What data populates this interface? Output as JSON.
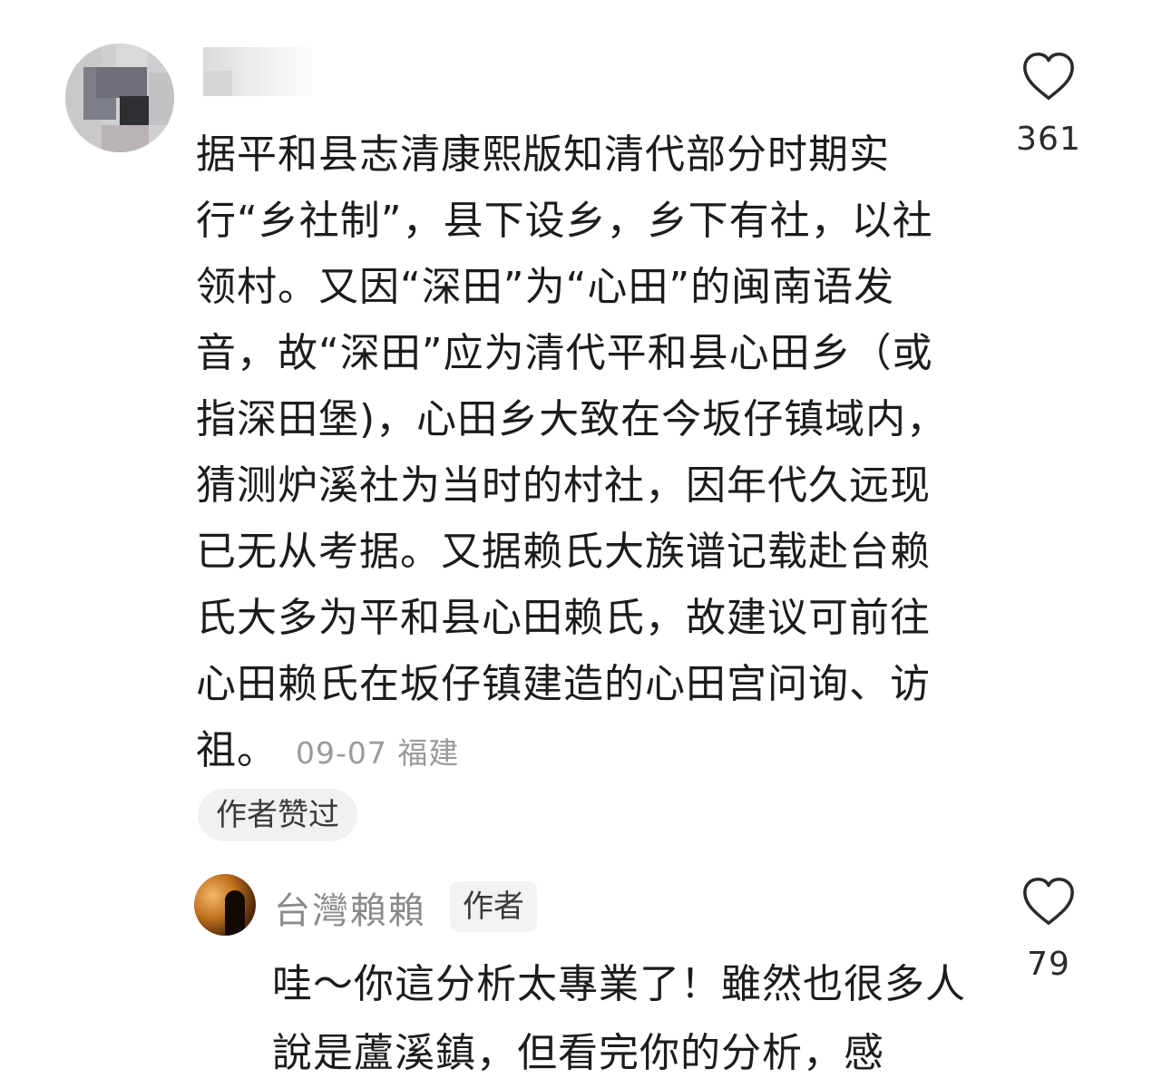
{
  "comment": {
    "avatar": "blurred-avatar",
    "username": "",
    "text": "据平和县志清康熙版知清代部分时期实行“乡社制”，县下设乡，乡下有社，以社领村。又因“深田”为“心田”的闽南语发音，故“深田”应为清代平和县心田乡（或指深田堡)，心田乡大致在今坂仔镇域内，猜测炉溪社为当时的村社，因年代久远现已无从考据。又据赖氏大族谱记载赴台赖氏大多为平和县心田赖氏，故建议可前往心田赖氏在坂仔镇建造的心田宫问询、访祖。",
    "date": "09-07",
    "location": "福建",
    "liked_by_author": "作者赞过",
    "like_icon": "heart-outline-icon",
    "like_count": "361"
  },
  "reply": {
    "avatar": "user-avatar",
    "username": "台灣賴賴",
    "author_badge": "作者",
    "text": "哇～你這分析太專業了！雖然也很多人說是蘆溪鎮，但看完你的分析，感",
    "like_icon": "heart-outline-icon",
    "like_count": "79"
  },
  "colors": {
    "text": "#1c1c1c",
    "meta": "#9a9a9a",
    "badge_bg": "#f1f1f1",
    "username": "#8a8a8a"
  }
}
